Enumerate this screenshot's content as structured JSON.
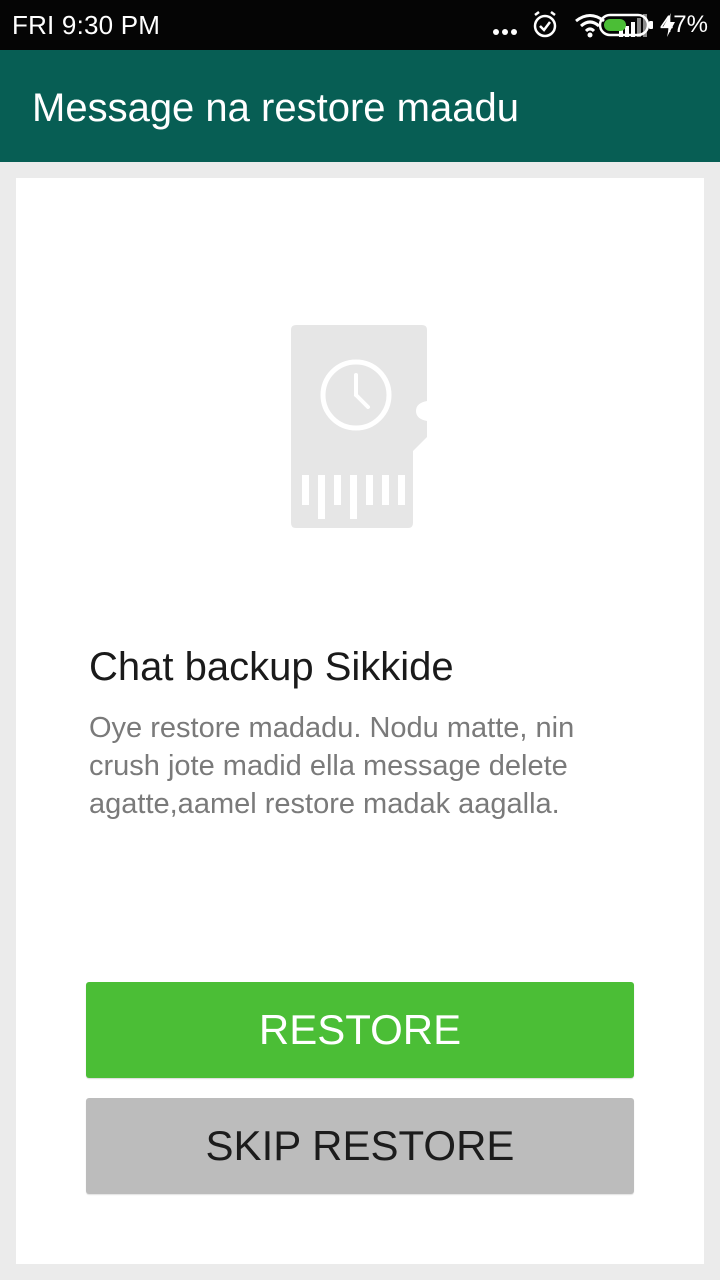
{
  "status_bar": {
    "time": "FRI 9:30 PM",
    "battery_percent": "47%",
    "battery_level": 0.47,
    "icons": [
      "more-dots-icon",
      "alarm-clock-icon",
      "wifi-icon",
      "signal-icon",
      "charging-bolt-icon",
      "battery-icon"
    ]
  },
  "app_bar": {
    "title": "Message na restore maadu",
    "color": "#075e54"
  },
  "content": {
    "illustration": "sd-card-clock-icon",
    "heading": "Chat backup Sikkide",
    "description": "Oye restore madadu. Nodu matte, nin crush jote madid ella message delete agatte,aamel restore madak aagalla."
  },
  "buttons": {
    "restore_label": "RESTORE",
    "restore_color": "#4bbe36",
    "skip_label": "SKIP RESTORE",
    "skip_color": "#bcbcbc"
  }
}
